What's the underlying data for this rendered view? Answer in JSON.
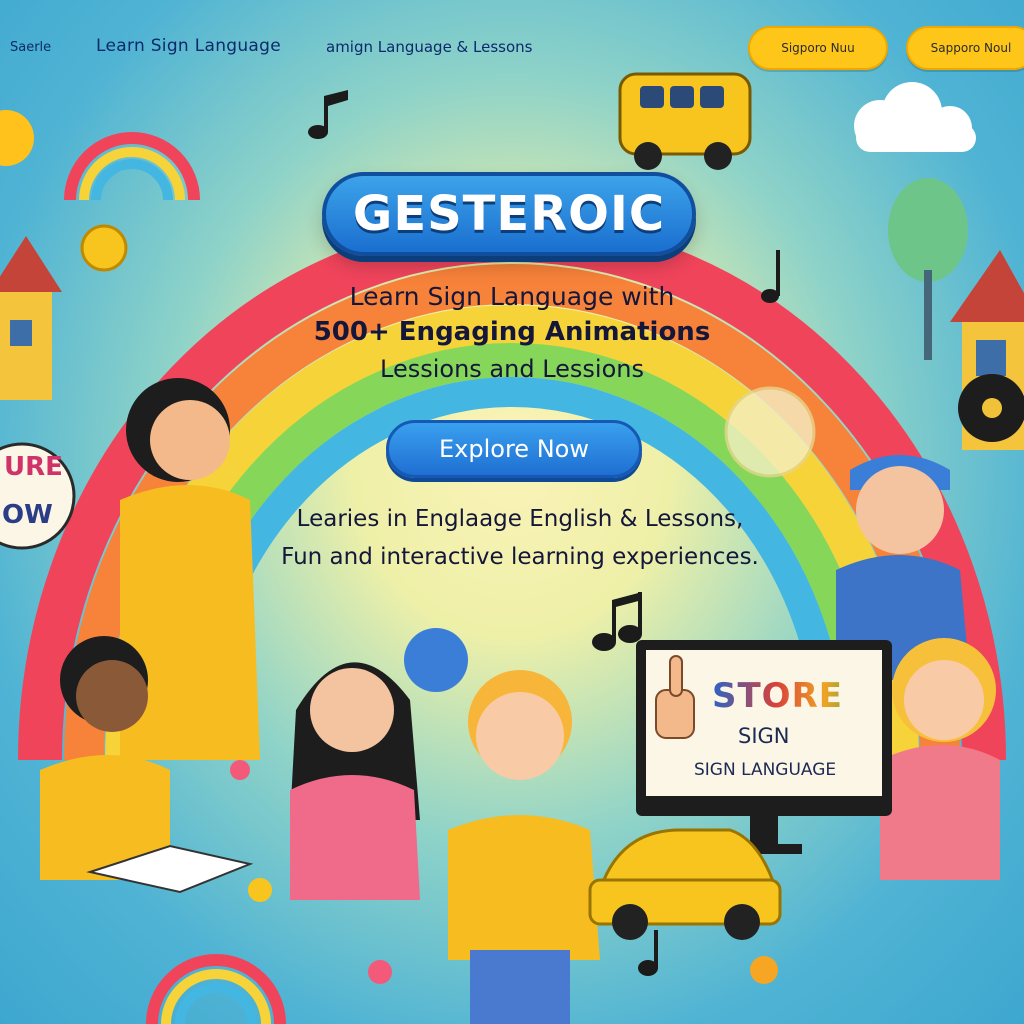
{
  "nav": {
    "search_label": "Saerle",
    "title": "Learn Sign Language",
    "subtitle": "amign Language & Lessons",
    "btn_primary": "Sigporo Nuu",
    "btn_secondary": "Sapporo Noul"
  },
  "hero": {
    "brand": "GESTEROIC",
    "headline_line1": "Learn Sign Language with",
    "headline_line2": "500+ Engaging Animations",
    "headline_line3": "Lessions and Lessions",
    "cta_label": "Explore Now",
    "sub_line1": "Learies in Englaage English & Lessons,",
    "sub_line2": "Fun and interactive learning experiences."
  },
  "signs": {
    "monitor_line1": "STORE",
    "monitor_line2": "SIGN",
    "monitor_line3": "SIGN LANGUAGE",
    "left_board_line1": "URE",
    "left_board_line2": "OW"
  },
  "colors": {
    "background_sky": "#4fb0d6",
    "center_glow": "#fbf3b8",
    "brand_blue": "#1a6fcf",
    "nav_button_yellow": "#ffc61a",
    "text_navy": "#14163a",
    "rainbow": [
      "#f0445b",
      "#f78a3a",
      "#f7d33a",
      "#7fd35a",
      "#3bb2e0"
    ]
  },
  "icons": [
    "music-note-icon",
    "sun-icon",
    "cloud-icon",
    "star-icon",
    "flower-icon",
    "vinyl-record-icon",
    "school-bus-icon",
    "car-icon",
    "house-icon",
    "tree-icon",
    "book-icon",
    "monitor-icon",
    "pointing-hand-icon"
  ]
}
